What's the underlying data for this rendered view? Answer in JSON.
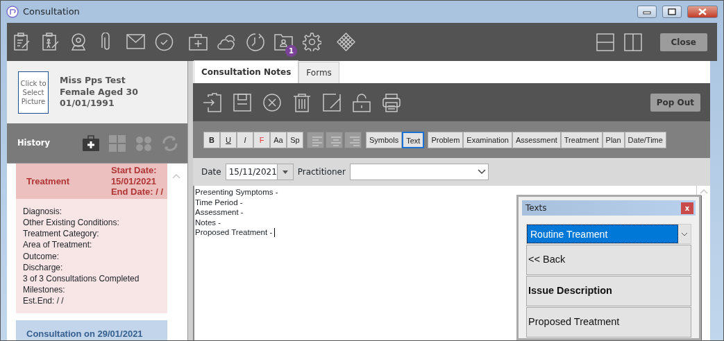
{
  "window": {
    "title": "Consultation"
  },
  "toolbar": {
    "badge": "1",
    "close": "Close"
  },
  "patient": {
    "picture_prompt": "Click to Select Picture",
    "name": "Miss Pps Test",
    "sex_age": "Female Aged 30",
    "dob": "01/01/1991"
  },
  "history": {
    "title": "History",
    "tools": [
      {
        "disabled": false
      },
      {
        "disabled": true
      },
      {
        "disabled": true
      },
      {
        "disabled": true
      }
    ],
    "cards": [
      {
        "kind": "treatment",
        "title": "Treatment",
        "dates": [
          "Start Date:",
          "15/01/2021",
          "End Date: / /"
        ],
        "lines": [
          "Diagnosis:",
          "Other Existing Conditions:",
          "Treatment Category:",
          "Area of Treatment:",
          "Outcome:",
          "Discharge:",
          "3 of 3 Consultations Completed",
          "Milestones:",
          "Est.End: / /"
        ]
      },
      {
        "kind": "consultation",
        "title": "Consultation on 29/01/2021"
      }
    ]
  },
  "tabs": [
    {
      "label": "Consultation Notes",
      "selected": true
    },
    {
      "label": "Forms",
      "selected": false
    }
  ],
  "notes_toolbar": {
    "pop_out": "Pop Out"
  },
  "format_buttons": [
    {
      "kind": "text",
      "label": "B",
      "selected": false
    },
    {
      "kind": "text",
      "label": "U",
      "selected": false
    },
    {
      "kind": "text",
      "label": "I",
      "selected": false
    },
    {
      "kind": "text",
      "label": "F",
      "selected": false
    },
    {
      "kind": "text",
      "label": "Aa",
      "selected": false
    },
    {
      "kind": "text",
      "label": "Sp",
      "selected": false
    },
    {
      "kind": "align",
      "selected": false
    },
    {
      "kind": "align",
      "selected": false
    },
    {
      "kind": "align",
      "selected": false
    },
    {
      "kind": "text",
      "label": "Symbols",
      "selected": false
    },
    {
      "kind": "text",
      "label": "Text",
      "selected": true
    },
    {
      "kind": "text",
      "label": "Problem",
      "selected": false
    },
    {
      "kind": "text",
      "label": "Examination",
      "selected": false
    },
    {
      "kind": "text",
      "label": "Assessment",
      "selected": false
    },
    {
      "kind": "text",
      "label": "Treatment",
      "selected": false
    },
    {
      "kind": "text",
      "label": "Plan",
      "selected": false
    },
    {
      "kind": "text",
      "label": "Date/Time",
      "selected": false
    }
  ],
  "date_row": {
    "date_label": "Date",
    "date": "15/11/2021",
    "practitioner_label": "Practitioner"
  },
  "notes": [
    "Presenting Symptoms -",
    "Time Period -",
    "Assessment -",
    "Notes -",
    "Proposed Treatment -"
  ],
  "texts_popup": {
    "title": "Texts",
    "close": "x",
    "selected_text": "Routine Treament",
    "items": [
      {
        "label": "<< Back",
        "bold": false
      },
      {
        "label": "Issue Description",
        "bold": true
      },
      {
        "label": "Proposed Treatment",
        "bold": false
      }
    ]
  }
}
